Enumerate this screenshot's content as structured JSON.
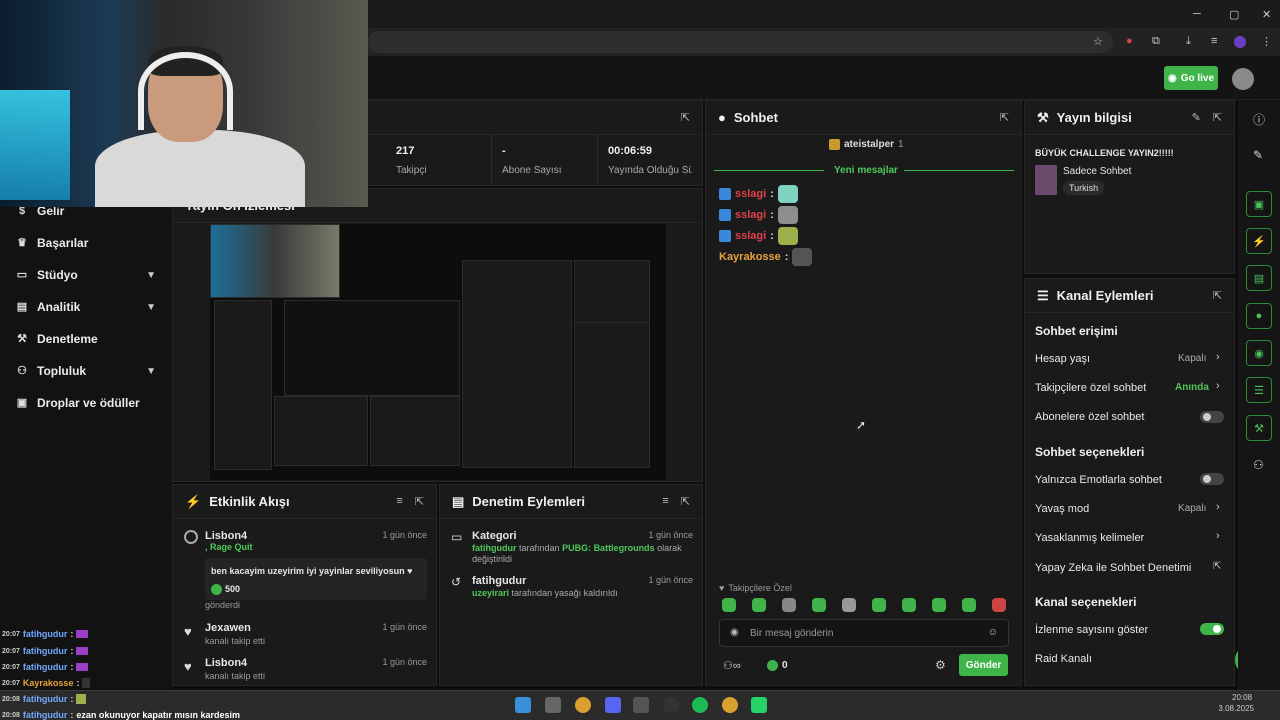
{
  "appbar": {
    "go_live": "Go live"
  },
  "sidebar": {
    "items": [
      {
        "label": "Gelir",
        "icon": "dollar-icon"
      },
      {
        "label": "Başarılar",
        "icon": "trophy-icon"
      },
      {
        "label": "Stüdyo",
        "icon": "studio-icon",
        "expandable": true
      },
      {
        "label": "Analitik",
        "icon": "chart-icon",
        "expandable": true
      },
      {
        "label": "Denetleme",
        "icon": "wrench-icon"
      },
      {
        "label": "Topluluk",
        "icon": "community-icon",
        "expandable": true
      },
      {
        "label": "Droplar ve ödüller",
        "icon": "gift-icon"
      }
    ]
  },
  "stats": {
    "followers_value": "217",
    "followers_label": "Takipçi",
    "subs_value": "-",
    "subs_label": "Abone Sayısı",
    "uptime_value": "00:06:59",
    "uptime_label": "Yayında Olduğu Sü..."
  },
  "preview": {
    "title": "Yayın Ön İzlemesi"
  },
  "activity": {
    "title": "Etkinlik Akışı",
    "items": [
      {
        "user": "Lisbon4",
        "time": "1 gün önce",
        "sub": ", Rage Quit",
        "message": "ben kacayim uzeyirim iyi yayinlar seviliyosun ♥",
        "amount": "500",
        "footer": "gönderdi"
      },
      {
        "user": "Jexawen",
        "time": "1 gün önce",
        "sub": "kanalı takip etti"
      },
      {
        "user": "Lisbon4",
        "time": "1 gün önce",
        "sub": "kanalı takip etti"
      }
    ]
  },
  "modlog": {
    "title": "Denetim Eylemleri",
    "items": [
      {
        "title": "Kategori",
        "time": "1 gün önce",
        "actor": "fatihgudur",
        "mid": "tarafından",
        "target": "PUBG: Battlegrounds",
        "tail": "olarak değiştirildi"
      },
      {
        "title": "fatihgudur",
        "time": "1 gün önce",
        "actor": "uzeyirari",
        "mid": "tarafından yasağı kaldırıldı"
      }
    ]
  },
  "chat": {
    "title": "Sohbet",
    "pinned_user": "ateistalper",
    "pinned_count": "1",
    "new_messages": "Yeni mesajlar",
    "lines": [
      {
        "user": "sslagi",
        "color": "#e0414b"
      },
      {
        "user": "sslagi",
        "color": "#e0414b"
      },
      {
        "user": "sslagi",
        "color": "#e0414b"
      },
      {
        "user": "Kayrakosse",
        "color": "#e8a23a"
      }
    ],
    "mode": "Takipçilere Özel",
    "input_placeholder": "Bir mesaj gönderin",
    "points": "0",
    "send": "Gönder"
  },
  "stream_info": {
    "title": "Yayın bilgisi",
    "stream_title": "BÜYÜK CHALLENGE YAYIN2!!!!!",
    "category": "Sadece Sohbet",
    "tag": "Turkish"
  },
  "channel_actions": {
    "title": "Kanal Eylemleri",
    "chat_access": "Sohbet erişimi",
    "account_age": "Hesap yaşı",
    "account_age_value": "Kapalı",
    "followers_only": "Takipçilere özel sohbet",
    "followers_only_value": "Anında",
    "subs_only": "Abonelere özel sohbet",
    "chat_options": "Sohbet seçenekleri",
    "emote_only": "Yalnızca Emotlarla sohbet",
    "slow_mode": "Yavaş mod",
    "slow_mode_value": "Kapalı",
    "banned_words": "Yasaklanmış kelimeler",
    "ai_moderation": "Yapay Zeka ile Sohbet Denetimi",
    "channel_options": "Kanal seçenekleri",
    "show_viewers": "İzlenme sayısını göster",
    "raid": "Raid Kanalı"
  },
  "overlay_chat": [
    {
      "time": "20:07",
      "user": "fatihgudur",
      "color": "#6fa8ff",
      "text": ""
    },
    {
      "time": "20:07",
      "user": "fatihgudur",
      "color": "#6fa8ff",
      "text": ""
    },
    {
      "time": "20:07",
      "user": "fatihgudur",
      "color": "#6fa8ff",
      "text": ""
    },
    {
      "time": "20:07",
      "user": "Kayrakosse",
      "color": "#e8a23a",
      "text": ""
    },
    {
      "time": "20:08",
      "user": "fatihgudur",
      "color": "#6fa8ff",
      "text": ""
    },
    {
      "time": "20:08",
      "user": "fatihgudur",
      "color": "#6fa8ff",
      "text": "ezan okunuyor kapatır mısın kardesim"
    }
  ],
  "taskbar": {
    "time": "20:08",
    "date": "3.08.2025"
  },
  "colors": {
    "accent": "#3fb549",
    "bg": "#0e0e0e",
    "panel": "#1a1a1a"
  }
}
